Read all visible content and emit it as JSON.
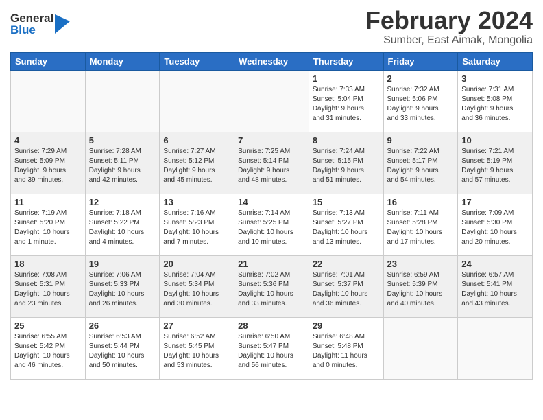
{
  "header": {
    "logo_general": "General",
    "logo_blue": "Blue",
    "month_year": "February 2024",
    "location": "Sumber, East Aimak, Mongolia"
  },
  "weekdays": [
    "Sunday",
    "Monday",
    "Tuesday",
    "Wednesday",
    "Thursday",
    "Friday",
    "Saturday"
  ],
  "weeks": [
    [
      {
        "day": "",
        "info": ""
      },
      {
        "day": "",
        "info": ""
      },
      {
        "day": "",
        "info": ""
      },
      {
        "day": "",
        "info": ""
      },
      {
        "day": "1",
        "info": "Sunrise: 7:33 AM\nSunset: 5:04 PM\nDaylight: 9 hours\nand 31 minutes."
      },
      {
        "day": "2",
        "info": "Sunrise: 7:32 AM\nSunset: 5:06 PM\nDaylight: 9 hours\nand 33 minutes."
      },
      {
        "day": "3",
        "info": "Sunrise: 7:31 AM\nSunset: 5:08 PM\nDaylight: 9 hours\nand 36 minutes."
      }
    ],
    [
      {
        "day": "4",
        "info": "Sunrise: 7:29 AM\nSunset: 5:09 PM\nDaylight: 9 hours\nand 39 minutes."
      },
      {
        "day": "5",
        "info": "Sunrise: 7:28 AM\nSunset: 5:11 PM\nDaylight: 9 hours\nand 42 minutes."
      },
      {
        "day": "6",
        "info": "Sunrise: 7:27 AM\nSunset: 5:12 PM\nDaylight: 9 hours\nand 45 minutes."
      },
      {
        "day": "7",
        "info": "Sunrise: 7:25 AM\nSunset: 5:14 PM\nDaylight: 9 hours\nand 48 minutes."
      },
      {
        "day": "8",
        "info": "Sunrise: 7:24 AM\nSunset: 5:15 PM\nDaylight: 9 hours\nand 51 minutes."
      },
      {
        "day": "9",
        "info": "Sunrise: 7:22 AM\nSunset: 5:17 PM\nDaylight: 9 hours\nand 54 minutes."
      },
      {
        "day": "10",
        "info": "Sunrise: 7:21 AM\nSunset: 5:19 PM\nDaylight: 9 hours\nand 57 minutes."
      }
    ],
    [
      {
        "day": "11",
        "info": "Sunrise: 7:19 AM\nSunset: 5:20 PM\nDaylight: 10 hours\nand 1 minute."
      },
      {
        "day": "12",
        "info": "Sunrise: 7:18 AM\nSunset: 5:22 PM\nDaylight: 10 hours\nand 4 minutes."
      },
      {
        "day": "13",
        "info": "Sunrise: 7:16 AM\nSunset: 5:23 PM\nDaylight: 10 hours\nand 7 minutes."
      },
      {
        "day": "14",
        "info": "Sunrise: 7:14 AM\nSunset: 5:25 PM\nDaylight: 10 hours\nand 10 minutes."
      },
      {
        "day": "15",
        "info": "Sunrise: 7:13 AM\nSunset: 5:27 PM\nDaylight: 10 hours\nand 13 minutes."
      },
      {
        "day": "16",
        "info": "Sunrise: 7:11 AM\nSunset: 5:28 PM\nDaylight: 10 hours\nand 17 minutes."
      },
      {
        "day": "17",
        "info": "Sunrise: 7:09 AM\nSunset: 5:30 PM\nDaylight: 10 hours\nand 20 minutes."
      }
    ],
    [
      {
        "day": "18",
        "info": "Sunrise: 7:08 AM\nSunset: 5:31 PM\nDaylight: 10 hours\nand 23 minutes."
      },
      {
        "day": "19",
        "info": "Sunrise: 7:06 AM\nSunset: 5:33 PM\nDaylight: 10 hours\nand 26 minutes."
      },
      {
        "day": "20",
        "info": "Sunrise: 7:04 AM\nSunset: 5:34 PM\nDaylight: 10 hours\nand 30 minutes."
      },
      {
        "day": "21",
        "info": "Sunrise: 7:02 AM\nSunset: 5:36 PM\nDaylight: 10 hours\nand 33 minutes."
      },
      {
        "day": "22",
        "info": "Sunrise: 7:01 AM\nSunset: 5:37 PM\nDaylight: 10 hours\nand 36 minutes."
      },
      {
        "day": "23",
        "info": "Sunrise: 6:59 AM\nSunset: 5:39 PM\nDaylight: 10 hours\nand 40 minutes."
      },
      {
        "day": "24",
        "info": "Sunrise: 6:57 AM\nSunset: 5:41 PM\nDaylight: 10 hours\nand 43 minutes."
      }
    ],
    [
      {
        "day": "25",
        "info": "Sunrise: 6:55 AM\nSunset: 5:42 PM\nDaylight: 10 hours\nand 46 minutes."
      },
      {
        "day": "26",
        "info": "Sunrise: 6:53 AM\nSunset: 5:44 PM\nDaylight: 10 hours\nand 50 minutes."
      },
      {
        "day": "27",
        "info": "Sunrise: 6:52 AM\nSunset: 5:45 PM\nDaylight: 10 hours\nand 53 minutes."
      },
      {
        "day": "28",
        "info": "Sunrise: 6:50 AM\nSunset: 5:47 PM\nDaylight: 10 hours\nand 56 minutes."
      },
      {
        "day": "29",
        "info": "Sunrise: 6:48 AM\nSunset: 5:48 PM\nDaylight: 11 hours\nand 0 minutes."
      },
      {
        "day": "",
        "info": ""
      },
      {
        "day": "",
        "info": ""
      }
    ]
  ]
}
